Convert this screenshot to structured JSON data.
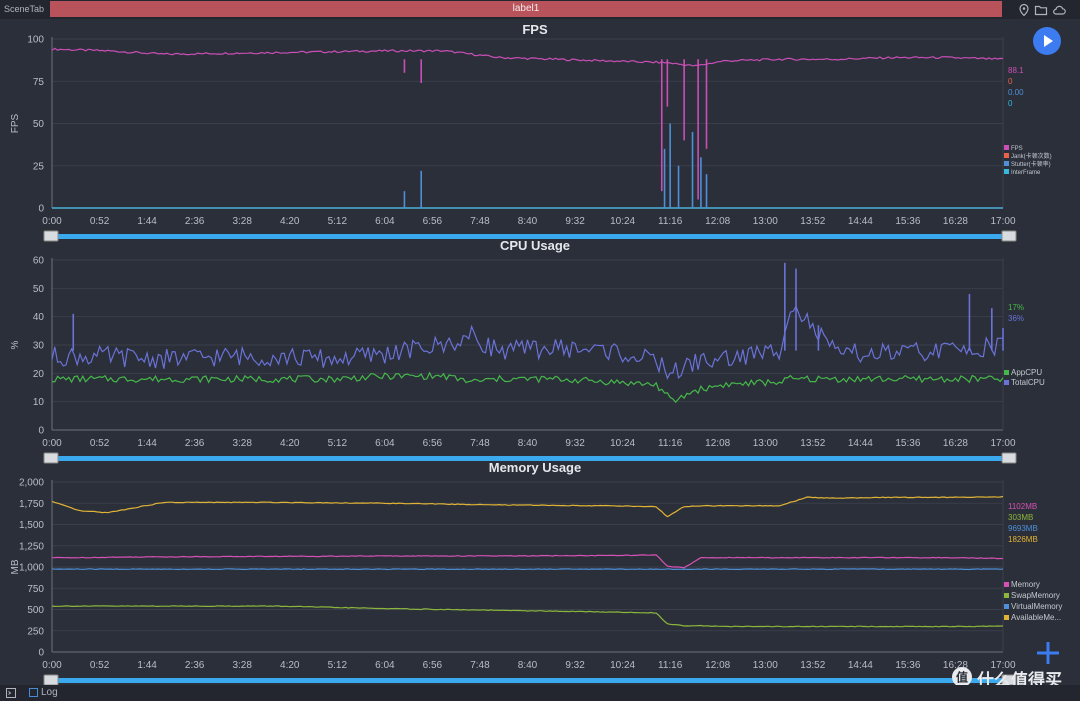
{
  "topbar": {
    "scene_tab": "SceneTab",
    "label_tab": "label1"
  },
  "icons": {
    "location": "location-pin-icon",
    "folder": "folder-icon",
    "cloud": "cloud-icon",
    "play": "play-icon",
    "add": "plus-icon",
    "terminal": "terminal-icon"
  },
  "bottombar": {
    "log_label": "Log"
  },
  "watermark": {
    "text": "什么值得买"
  },
  "colors": {
    "fps": "#c94fb6",
    "jank": "#e8624a",
    "stutter": "#4f8fd6",
    "interframe": "#37b8de",
    "appcpu": "#46b84a",
    "totalcpu": "#6a72d8",
    "memory": "#d552b4",
    "swap": "#8bb63c",
    "virtual": "#4f8fd6",
    "available": "#e0b335",
    "slider": "#3ba9ee"
  },
  "chart_data": [
    {
      "type": "line",
      "title": "FPS",
      "ylabel": "FPS",
      "ylim": [
        0,
        100
      ],
      "yticks": [
        "0",
        "25",
        "50",
        "75",
        "100"
      ],
      "xticks": [
        "0:00",
        "0:52",
        "1:44",
        "2:36",
        "3:28",
        "4:20",
        "5:12",
        "6:04",
        "6:56",
        "7:48",
        "8:40",
        "9:32",
        "10:24",
        "11:16",
        "12:08",
        "13:00",
        "13:52",
        "14:44",
        "15:36",
        "16:28",
        "17:00"
      ],
      "x_minutes": [
        0,
        1,
        2,
        4,
        6,
        7,
        8,
        9,
        10,
        11,
        11.5,
        12,
        13,
        14,
        15,
        16,
        17
      ],
      "series": [
        {
          "name": "FPS",
          "current": "88.1",
          "values": [
            94,
            93,
            91,
            92,
            93,
            93,
            89,
            88,
            87,
            86,
            84,
            87,
            88,
            88,
            89,
            89,
            88
          ]
        },
        {
          "name": "Jank(卡顿次数)",
          "current": "0",
          "values": [
            0,
            0,
            0,
            0,
            0,
            0,
            0,
            0,
            0,
            0,
            0,
            0,
            0,
            0,
            0,
            0,
            0
          ]
        },
        {
          "name": "Stutter(卡顿率)",
          "current": "0.00",
          "values": [
            0,
            0,
            0,
            0,
            0,
            0,
            0,
            0,
            0,
            0,
            0,
            0,
            0,
            0,
            0,
            0,
            0
          ]
        },
        {
          "name": "InterFrame",
          "current": "0",
          "values": [
            0,
            0,
            0,
            0,
            0,
            0,
            0,
            0,
            0,
            0,
            0,
            0,
            0,
            0,
            0,
            0,
            0
          ]
        }
      ],
      "spikes": {
        "fps_drops": [
          {
            "x": 6.3,
            "y": 80
          },
          {
            "x": 6.6,
            "y": 74
          },
          {
            "x": 10.9,
            "y": 10
          },
          {
            "x": 11.0,
            "y": 60
          },
          {
            "x": 11.3,
            "y": 40
          },
          {
            "x": 11.55,
            "y": 5
          },
          {
            "x": 11.7,
            "y": 35
          }
        ],
        "stutter_spikes": [
          {
            "x": 6.3,
            "y": 10
          },
          {
            "x": 6.6,
            "y": 22
          },
          {
            "x": 10.95,
            "y": 35
          },
          {
            "x": 11.05,
            "y": 50
          },
          {
            "x": 11.2,
            "y": 25
          },
          {
            "x": 11.45,
            "y": 45
          },
          {
            "x": 11.6,
            "y": 30
          },
          {
            "x": 11.7,
            "y": 20
          }
        ]
      }
    },
    {
      "type": "line",
      "title": "CPU Usage",
      "ylabel": "%",
      "ylim": [
        0,
        60
      ],
      "yticks": [
        "0",
        "10",
        "20",
        "30",
        "40",
        "50",
        "60"
      ],
      "xticks": [
        "0:00",
        "0:52",
        "1:44",
        "2:36",
        "3:28",
        "4:20",
        "5:12",
        "6:04",
        "6:56",
        "7:48",
        "8:40",
        "9:32",
        "10:24",
        "11:16",
        "12:08",
        "13:00",
        "13:52",
        "14:44",
        "15:36",
        "16:28",
        "17:00"
      ],
      "x_minutes": [
        0,
        1,
        2,
        3,
        4,
        5,
        6,
        7,
        7.5,
        8,
        9,
        10,
        10.8,
        11.1,
        11.5,
        12,
        13,
        13.2,
        14,
        15,
        16,
        17
      ],
      "series": [
        {
          "name": "AppCPU",
          "current": "17%",
          "values": [
            18,
            18,
            18,
            18,
            18,
            18,
            19,
            19,
            17,
            18,
            18,
            17,
            16,
            10,
            14,
            16,
            17,
            18,
            18,
            18,
            18,
            18
          ]
        },
        {
          "name": "TotalCPU",
          "current": "36%",
          "values": [
            26,
            26,
            25,
            26,
            26,
            25,
            27,
            30,
            33,
            28,
            29,
            28,
            24,
            20,
            24,
            25,
            28,
            45,
            27,
            27,
            28,
            30
          ]
        }
      ],
      "spikes": {
        "totalcpu": [
          {
            "x": 0.38,
            "y": 41
          },
          {
            "x": 13.1,
            "y": 59
          },
          {
            "x": 13.3,
            "y": 57
          },
          {
            "x": 13.7,
            "y": 37
          },
          {
            "x": 16.4,
            "y": 48
          },
          {
            "x": 16.8,
            "y": 43
          },
          {
            "x": 17.0,
            "y": 36
          }
        ]
      }
    },
    {
      "type": "line",
      "title": "Memory Usage",
      "ylabel": "MB",
      "ylim": [
        0,
        2000
      ],
      "yticks": [
        "0",
        "250",
        "500",
        "750",
        "1,000",
        "1,250",
        "1,500",
        "1,750",
        "2,000"
      ],
      "xticks": [
        "0:00",
        "0:52",
        "1:44",
        "2:36",
        "3:28",
        "4:20",
        "5:12",
        "6:04",
        "6:56",
        "7:48",
        "8:40",
        "9:32",
        "10:24",
        "11:16",
        "12:08",
        "13:00",
        "13:52",
        "14:44",
        "15:36",
        "16:28",
        "17:00"
      ],
      "x_minutes": [
        0,
        0.5,
        1,
        2,
        4,
        6,
        8,
        10,
        10.8,
        11,
        11.3,
        11.6,
        12,
        13,
        13.5,
        14,
        15,
        16,
        17
      ],
      "series": [
        {
          "name": "Memory",
          "current": "1102MB",
          "values": [
            1110,
            1110,
            1115,
            1120,
            1125,
            1130,
            1130,
            1135,
            1140,
            1010,
            990,
            1110,
            1110,
            1110,
            1110,
            1110,
            1110,
            1110,
            1100
          ]
        },
        {
          "name": "SwapMemory",
          "current": "303MB",
          "values": [
            540,
            540,
            540,
            540,
            540,
            510,
            490,
            470,
            460,
            330,
            310,
            310,
            300,
            300,
            300,
            300,
            300,
            300,
            303
          ]
        },
        {
          "name": "VirtualMemory",
          "current": "9693MB",
          "values": [
            975,
            975,
            975,
            975,
            975,
            975,
            975,
            975,
            975,
            975,
            975,
            975,
            975,
            975,
            975,
            975,
            975,
            975,
            975
          ]
        },
        {
          "name": "AvailableMe...",
          "current": "1826MB",
          "values": [
            1770,
            1660,
            1640,
            1760,
            1760,
            1750,
            1730,
            1720,
            1710,
            1590,
            1710,
            1720,
            1720,
            1720,
            1820,
            1810,
            1820,
            1820,
            1826
          ]
        }
      ]
    }
  ]
}
